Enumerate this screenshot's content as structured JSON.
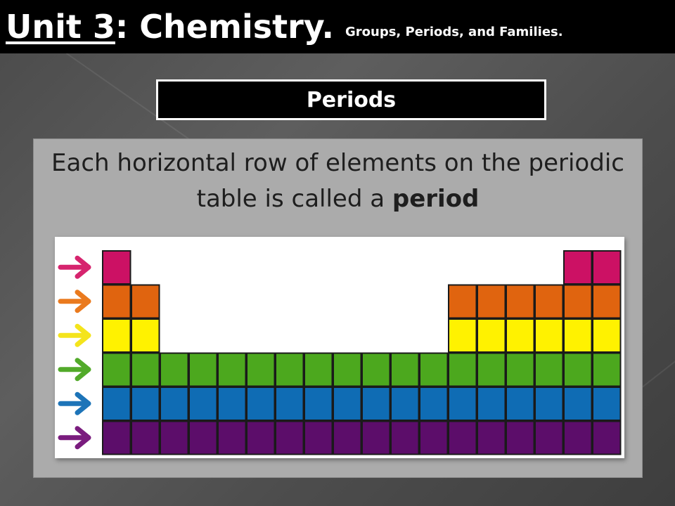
{
  "title": {
    "unit": "Unit 3",
    "main_rest": ": Chemistry.",
    "subtitle": "Groups, Periods, and Families."
  },
  "section": {
    "label": "Periods"
  },
  "body": {
    "text_before": "Each horizontal row of elements on the periodic table is called a ",
    "bold_term": "period"
  },
  "figure": {
    "icon": "periodic-table-arrows",
    "period_colors": [
      "#cc1164",
      "#e0640f",
      "#fff200",
      "#4ca81e",
      "#0f6cb4",
      "#5c0d6a"
    ],
    "arrow_colors": [
      "#d6246e",
      "#ea7a1e",
      "#f4e41c",
      "#52aa2a",
      "#1d74b8",
      "#7a1c7e"
    ]
  }
}
